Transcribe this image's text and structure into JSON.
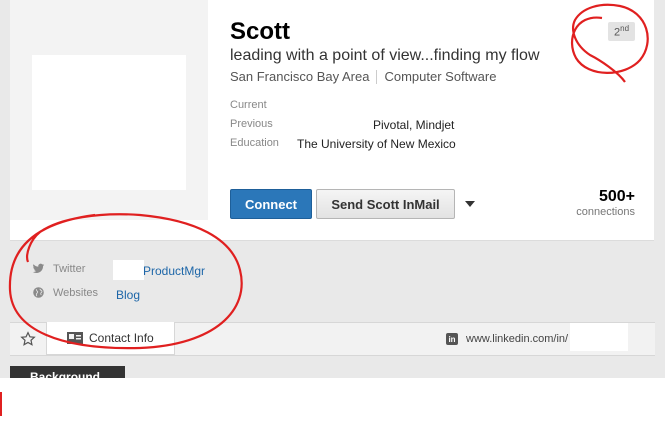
{
  "profile": {
    "name": "Scott",
    "headline": "leading with a point of view...finding my flow",
    "location": "San Francisco Bay Area",
    "industry": "Computer Software",
    "degree": "2",
    "degree_suffix": "nd"
  },
  "details": {
    "current_label": "Current",
    "previous_label": "Previous",
    "previous_value": "Pivotal, Mindjet",
    "education_label": "Education",
    "education_value": "The University of New Mexico"
  },
  "actions": {
    "connect_label": "Connect",
    "inmail_label": "Send Scott InMail"
  },
  "connections": {
    "count": "500+",
    "label": "connections"
  },
  "social": {
    "twitter_label": "Twitter",
    "twitter_link": "ProductMgr",
    "websites_label": "Websites",
    "websites_link": "Blog"
  },
  "contact_bar": {
    "contact_label": "Contact Info",
    "url": "www.linkedin.com/in/"
  },
  "section_tab": {
    "label": "Background"
  },
  "colors": {
    "accent": "#2b77b9",
    "link": "#1d66a8",
    "annotation": "#e02020"
  }
}
